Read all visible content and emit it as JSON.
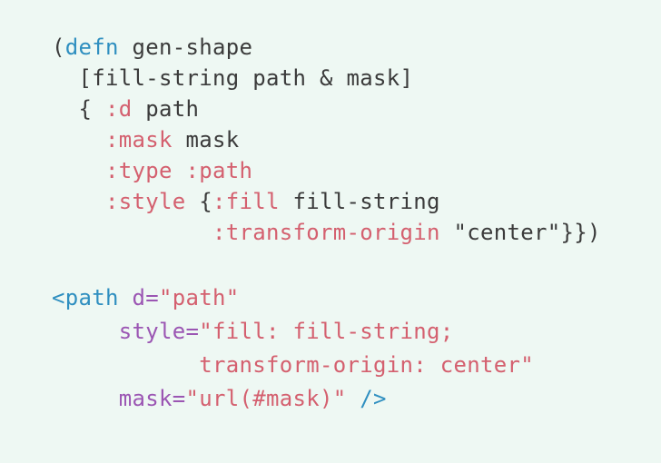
{
  "clojure": {
    "l1_open": "(",
    "l1_defn": "defn",
    "l1_name": " gen-shape",
    "l2": "  [fill-string path & mask]",
    "l3_open": "  { ",
    "l3_kw": ":d",
    "l3_val": " path",
    "l4_indent": "    ",
    "l4_kw": ":mask",
    "l4_val": " mask",
    "l5_indent": "    ",
    "l5_kw": ":type :path",
    "l6_indent": "    ",
    "l6_kw": ":style",
    "l6_brace": " {",
    "l6_kw2": ":fill",
    "l6_val": " fill-string",
    "l7_indent": "            ",
    "l7_kw": ":transform-origin",
    "l7_val": " \"center\"}})"
  },
  "html": {
    "l1_tag": "<path",
    "l1_space": " ",
    "l1_attr": "d=",
    "l1_str": "\"path\"",
    "l2_indent": "     ",
    "l2_attr": "style=",
    "l2_str": "\"fill: fill-string;",
    "l3_indent": "           ",
    "l3_str": "transform-origin: center\"",
    "l4_indent": "     ",
    "l4_attr": "mask=",
    "l4_str": "\"url(#mask)\"",
    "l4_close": " />"
  }
}
